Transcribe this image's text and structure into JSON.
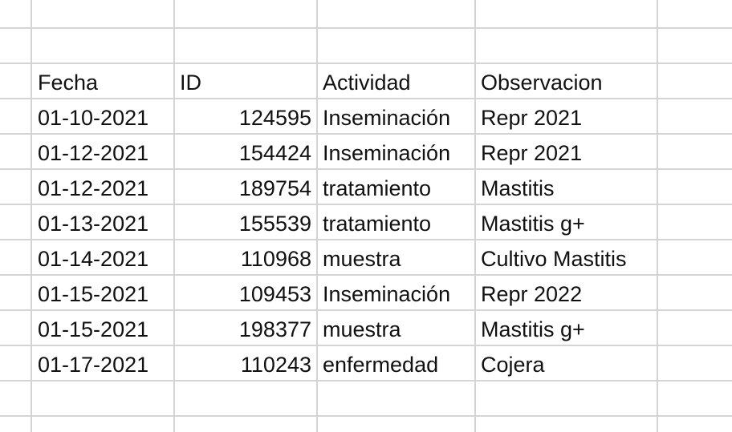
{
  "headers": {
    "fecha": "Fecha",
    "id": "ID",
    "actividad": "Actividad",
    "observacion": "Observacion"
  },
  "rows": [
    {
      "fecha": "01-10-2021",
      "id": "124595",
      "actividad": "Inseminación",
      "observacion": "Repr 2021"
    },
    {
      "fecha": "01-12-2021",
      "id": "154424",
      "actividad": "Inseminación",
      "observacion": "Repr 2021"
    },
    {
      "fecha": "01-12-2021",
      "id": "189754",
      "actividad": "tratamiento",
      "observacion": "Mastitis"
    },
    {
      "fecha": "01-13-2021",
      "id": "155539",
      "actividad": "tratamiento",
      "observacion": "Mastitis g+"
    },
    {
      "fecha": "01-14-2021",
      "id": "110968",
      "actividad": "muestra",
      "observacion": "Cultivo Mastitis"
    },
    {
      "fecha": "01-15-2021",
      "id": "109453",
      "actividad": "Inseminación",
      "observacion": "Repr 2022"
    },
    {
      "fecha": "01-15-2021",
      "id": "198377",
      "actividad": "muestra",
      "observacion": "Mastitis g+"
    },
    {
      "fecha": "01-17-2021",
      "id": "110243",
      "actividad": "enfermedad",
      "observacion": "Cojera"
    }
  ]
}
